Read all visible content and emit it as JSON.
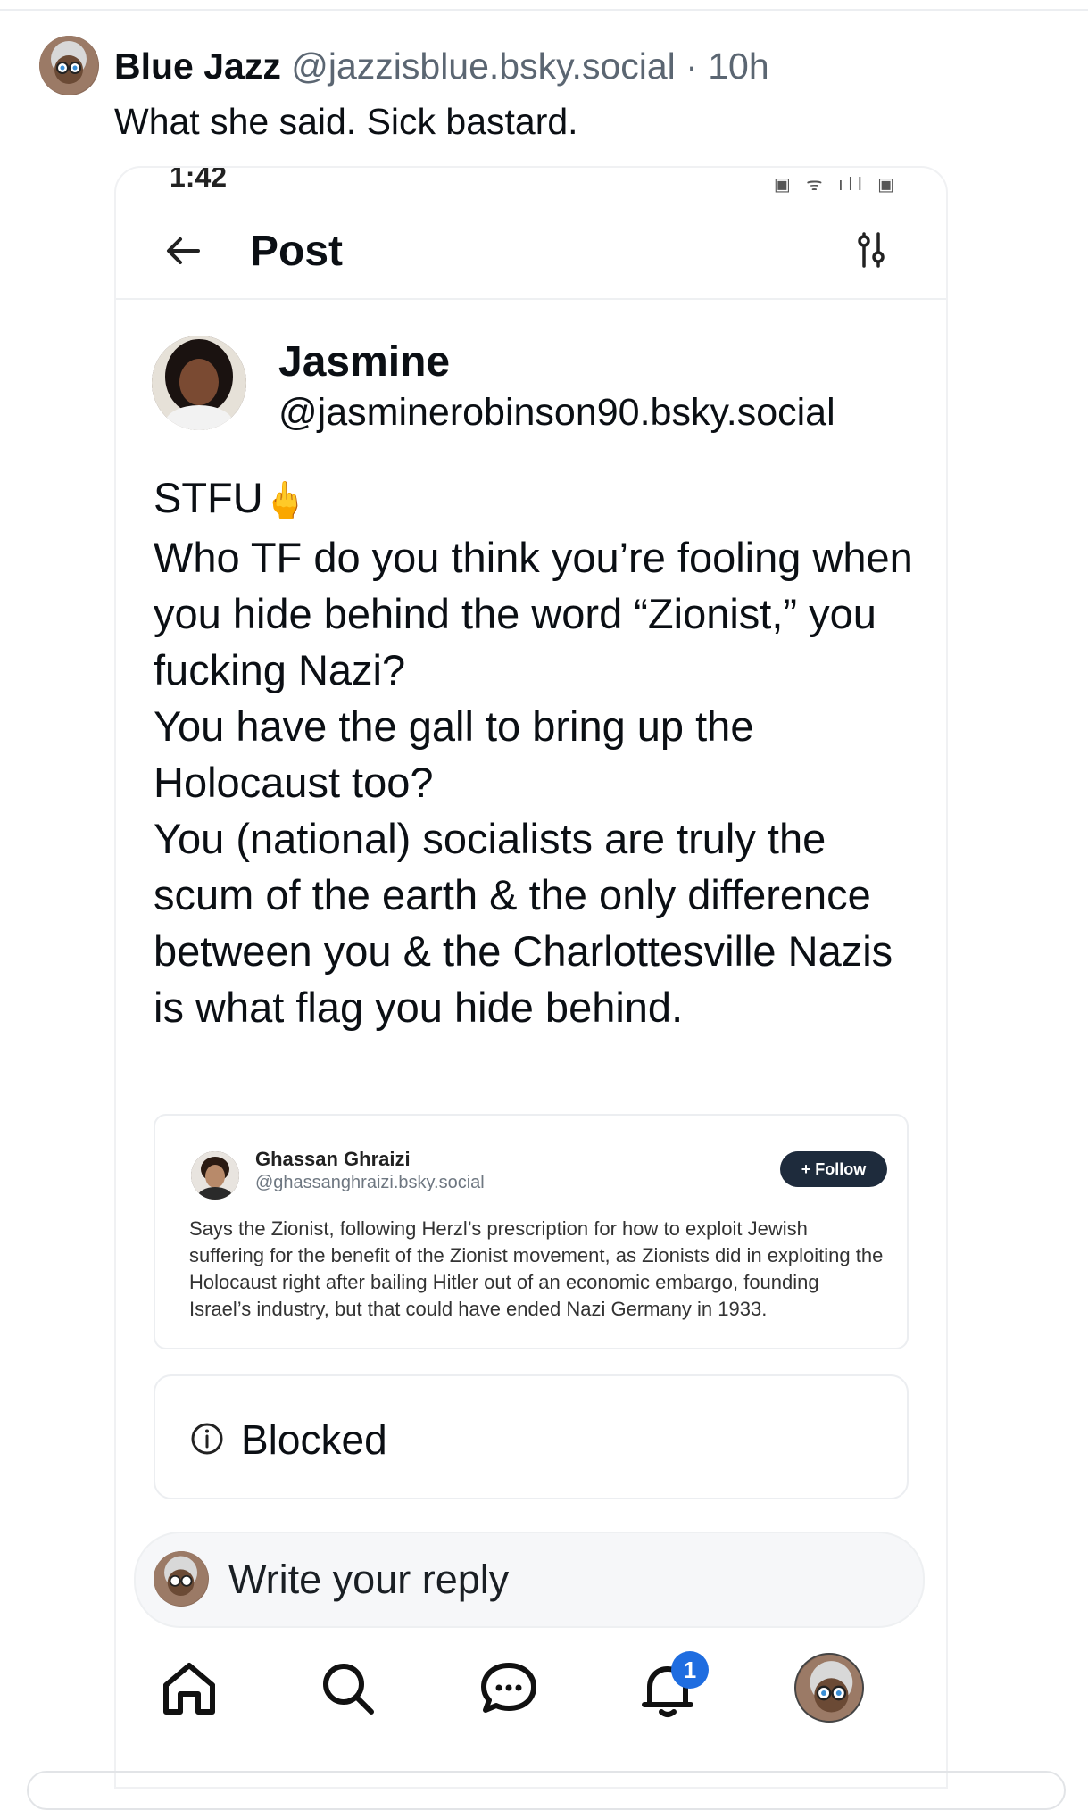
{
  "outer_post": {
    "display_name": "Blue Jazz",
    "handle": "@jazzisblue.bsky.social",
    "separator": "·",
    "time": "10h",
    "text": "What she said. Sick bastard."
  },
  "screenshot": {
    "status_time": "1:42",
    "header_title": "Post",
    "author": {
      "name": "Jasmine",
      "handle": "@jasminerobinson90.bsky.social"
    },
    "body": {
      "line1_text": "STFU",
      "line1_emoji": "🖕",
      "paragraphs": [
        "Who TF do you think you’re fooling when you hide behind the word “Zionist,” you fucking Nazi?",
        "You have the gall to bring up the Holocaust too?",
        "You (national) socialists are truly the scum of the earth & the only difference between you & the Charlottesville Nazis is what flag you hide behind."
      ]
    },
    "quote": {
      "name": "Ghassan Ghraizi",
      "handle": "@ghassanghraizi.bsky.social",
      "follow_label": "+ Follow",
      "text": "Says the Zionist, following Herzl’s prescription for how to exploit Jewish suffering for the benefit of the Zionist movement, as Zionists did in exploiting the Holocaust right after bailing Hitler out of an economic embargo, founding Israel’s industry, but that could have ended Nazi Germany in 1933."
    },
    "blocked_label": "Blocked",
    "reply_placeholder": "Write your reply",
    "notification_count": "1",
    "icons": [
      "back-arrow-icon",
      "settings-sliders-icon",
      "info-icon",
      "home-icon",
      "search-icon",
      "chat-icon",
      "bell-icon"
    ]
  }
}
